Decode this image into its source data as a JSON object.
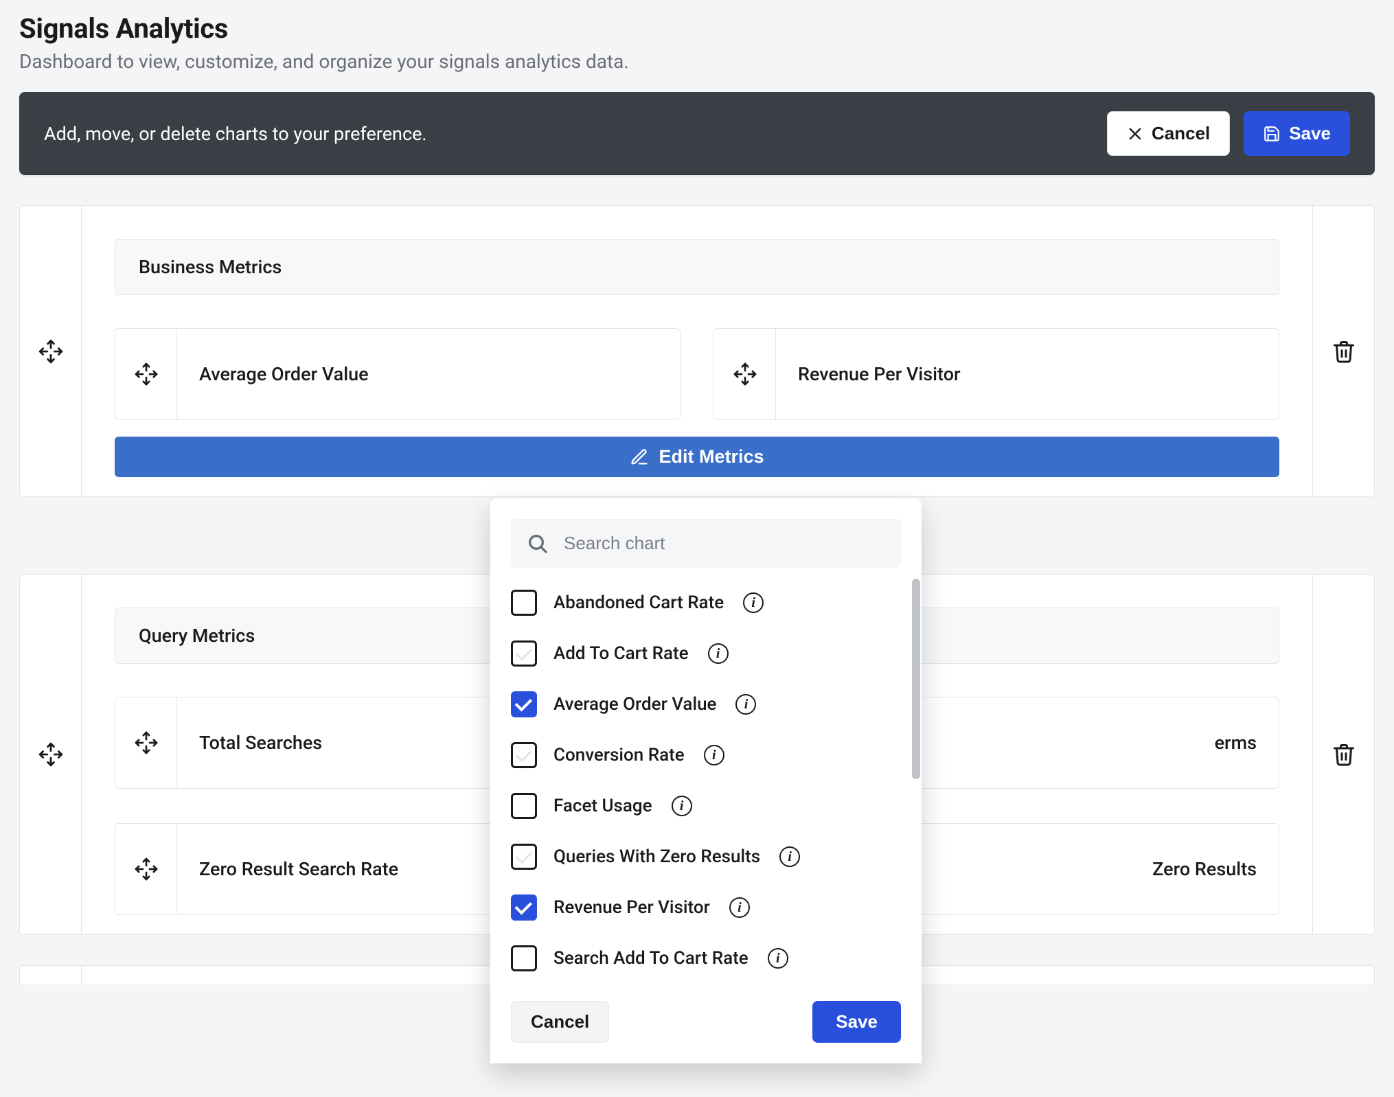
{
  "page": {
    "title": "Signals Analytics",
    "subtitle": "Dashboard to view, customize, and organize your signals analytics data."
  },
  "actionbar": {
    "message": "Add, move, or delete charts to your preference.",
    "cancel": "Cancel",
    "save": "Save"
  },
  "panels": [
    {
      "header": "Business Metrics",
      "edit_label": "Edit Metrics",
      "metrics": [
        "Average Order Value",
        "Revenue Per Visitor"
      ]
    },
    {
      "header": "Query Metrics",
      "metrics_row1": [
        "Total Searches",
        "erms"
      ],
      "metrics_row2": [
        "Zero Result Search Rate",
        "Zero Results"
      ]
    }
  ],
  "popup": {
    "search_placeholder": "Search chart",
    "items": [
      {
        "label": "Abandoned Cart Rate",
        "checked": false,
        "faint": false
      },
      {
        "label": "Add To Cart Rate",
        "checked": false,
        "faint": true
      },
      {
        "label": "Average Order Value",
        "checked": true,
        "faint": false
      },
      {
        "label": "Conversion Rate",
        "checked": false,
        "faint": true
      },
      {
        "label": "Facet Usage",
        "checked": false,
        "faint": false
      },
      {
        "label": "Queries With Zero Results",
        "checked": false,
        "faint": true
      },
      {
        "label": "Revenue Per Visitor",
        "checked": true,
        "faint": false
      },
      {
        "label": "Search Add To Cart Rate",
        "checked": false,
        "faint": false
      }
    ],
    "cancel": "Cancel",
    "save": "Save"
  }
}
